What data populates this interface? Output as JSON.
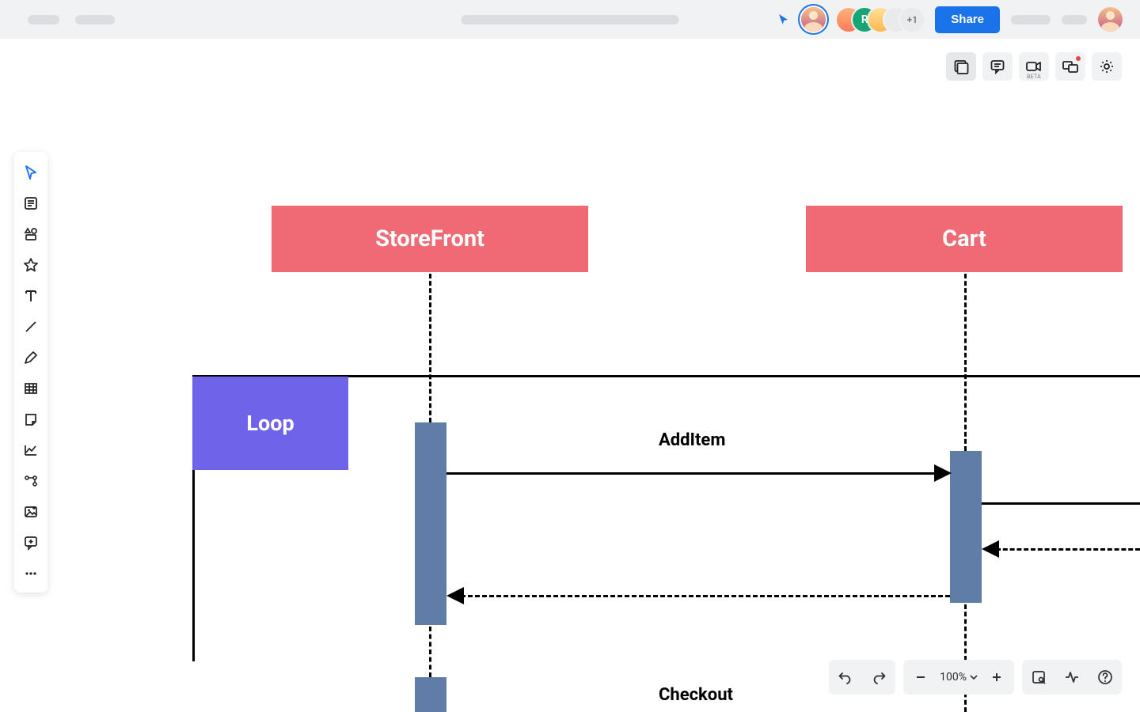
{
  "topbar": {
    "share_label": "Share",
    "more_collaborators": "+1",
    "avatar_green_initial": "R"
  },
  "bottom_bar": {
    "zoom_label": "100%"
  },
  "diagram": {
    "kind": "sequence",
    "participants": [
      {
        "id": "storefront",
        "label": "StoreFront"
      },
      {
        "id": "cart",
        "label": "Cart"
      }
    ],
    "fragment": {
      "type": "loop",
      "label": "Loop"
    },
    "messages": [
      {
        "id": "m1",
        "label": "AddItem",
        "from": "storefront",
        "to": "cart",
        "style": "solid",
        "direction": "right"
      },
      {
        "id": "m2",
        "label": "",
        "from": "cart",
        "to": "offscreen",
        "style": "solid",
        "direction": "right"
      },
      {
        "id": "m3",
        "label": "",
        "from": "offscreen",
        "to": "cart",
        "style": "dashed",
        "direction": "left"
      },
      {
        "id": "m4",
        "label": "",
        "from": "cart",
        "to": "storefront",
        "style": "dashed",
        "direction": "left"
      },
      {
        "id": "m5",
        "label": "Checkout",
        "from": "storefront",
        "to": "cart",
        "style": "solid",
        "direction": "right"
      }
    ]
  }
}
